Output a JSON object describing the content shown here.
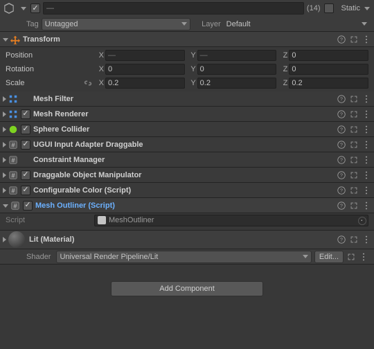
{
  "header": {
    "name_value": "—",
    "count_badge": "(14)",
    "static_label": "Static",
    "tag_label": "Tag",
    "tag_value": "Untagged",
    "layer_label": "Layer",
    "layer_value": "Default"
  },
  "transform": {
    "title": "Transform",
    "position_label": "Position",
    "rotation_label": "Rotation",
    "scale_label": "Scale",
    "pos": {
      "x": "—",
      "y": "—",
      "z": "0"
    },
    "rot": {
      "x": "0",
      "y": "0",
      "z": "0"
    },
    "scale": {
      "x": "0.2",
      "y": "0.2",
      "z": "0.2"
    },
    "axis": {
      "x": "X",
      "y": "Y",
      "z": "Z"
    }
  },
  "components": [
    {
      "title": "Mesh Filter",
      "checkbox": null,
      "icon": "mesh-filter"
    },
    {
      "title": "Mesh Renderer",
      "checkbox": true,
      "icon": "mesh-renderer"
    },
    {
      "title": "Sphere Collider",
      "checkbox": true,
      "icon": "sphere-collider"
    },
    {
      "title": "UGUI Input Adapter Draggable",
      "checkbox": true,
      "icon": "script"
    },
    {
      "title": "Constraint Manager",
      "checkbox": null,
      "icon": "script"
    },
    {
      "title": "Draggable Object Manipulator",
      "checkbox": true,
      "icon": "script"
    },
    {
      "title": "Configurable Color (Script)",
      "checkbox": true,
      "icon": "script"
    },
    {
      "title": "Mesh Outliner (Script)",
      "checkbox": true,
      "icon": "script",
      "expanded": true,
      "highlight": true
    }
  ],
  "outliner": {
    "script_label": "Script",
    "script_value": "MeshOutliner"
  },
  "material": {
    "title": "Lit (Material)",
    "shader_label": "Shader",
    "shader_value": "Universal Render Pipeline/Lit",
    "edit_label": "Edit..."
  },
  "add_component_label": "Add Component"
}
